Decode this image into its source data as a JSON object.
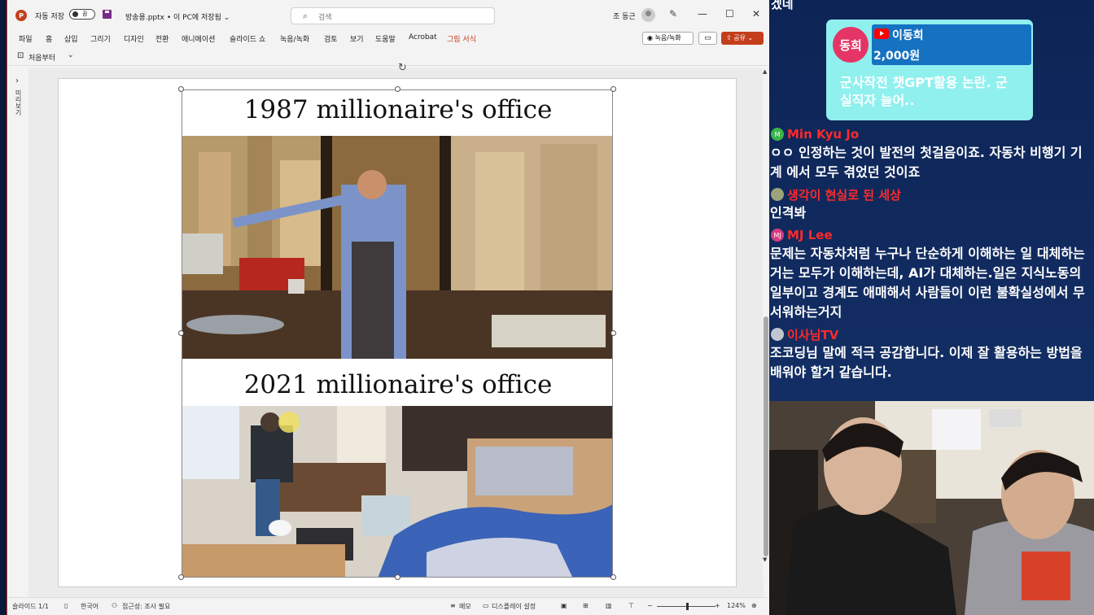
{
  "titlebar": {
    "autosave_label": "자동 저장",
    "autosave_state": "끔",
    "document": "방송용.pptx • 이 PC에 저장됨 ⌄",
    "search_placeholder": "검색",
    "user": "조 동근",
    "app_icon": "P"
  },
  "menu": {
    "items": [
      "파일",
      "홈",
      "삽입",
      "그리기",
      "디자인",
      "전환",
      "애니메이션",
      "슬라이드 쇼",
      "녹음/녹화",
      "검토",
      "보기",
      "도움말",
      "Acrobat",
      "그림 서식"
    ],
    "record_button": "녹음/녹화",
    "share_button": "공유"
  },
  "quick": {
    "from_start": "처음부터"
  },
  "left_panel": {
    "label": "미리보기"
  },
  "slide": {
    "title_top": "1987 millionaire's office",
    "title_bottom": "2021 millionaire's office"
  },
  "status": {
    "slide_count": "슬라이드 1/1",
    "language": "한국어",
    "accessibility": "접근성: 조사 필요",
    "notes": "메모",
    "display_settings": "디스플레이 설정",
    "zoom": "124%"
  },
  "stream": {
    "top_cut_text": "겠네",
    "donation": {
      "badge": "동희",
      "name": "이동희",
      "amount": "2,000원",
      "message": "군사작전 챗GPT활용 논란. 군 실직자 늘어.."
    },
    "chat": [
      {
        "name": "Min Kyu Jo",
        "initial": "M",
        "avatar_color": "#3bb54a",
        "text": "ㅇㅇ 인정하는 것이 발전의 첫걸음이죠. 자동차 비행기 기계 에서 모두 겪었던 것이죠"
      },
      {
        "name": "생각이 현실로 된 세상",
        "initial": "",
        "avatar_color": "#9aa37a",
        "text": "인격봐"
      },
      {
        "name": "MJ Lee",
        "initial": "MJ",
        "avatar_color": "#d63b7f",
        "text": "문제는 자동차처럼 누구나 단순하게 이해하는 일 대체하는거는 모두가 이해하는데, AI가 대체하는.일은 지식노동의 일부이고 경계도 애매해서 사람들이 이런 불확실성에서 무서워하는거지"
      },
      {
        "name": "이사님TV",
        "initial": "",
        "avatar_color": "#bfc6d0",
        "text": "조코딩님 말에 적극 공감합니다. 이제 잘 활용하는 방법을 배워야 할거 같습니다."
      }
    ]
  },
  "colors": {
    "accent": "#c43e1c",
    "chat_name": "#ff2a2a",
    "donation_bg": "#8ff0ee",
    "donation_head": "#1572c1"
  }
}
